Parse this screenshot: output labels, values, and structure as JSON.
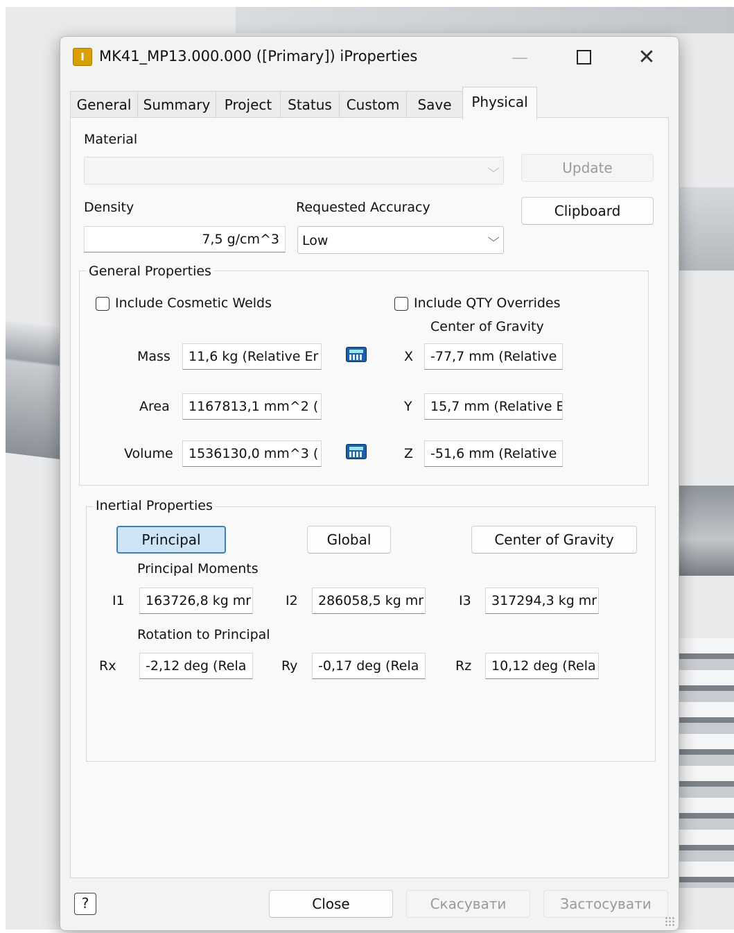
{
  "window": {
    "app_icon_letter": "I",
    "title": "MK41_MP13.000.000 ([Primary]) iProperties",
    "minimize_glyph": "—",
    "close_glyph": "✕"
  },
  "tabs": [
    {
      "label": "General"
    },
    {
      "label": "Summary"
    },
    {
      "label": "Project"
    },
    {
      "label": "Status"
    },
    {
      "label": "Custom"
    },
    {
      "label": "Save"
    },
    {
      "label": "Physical",
      "active": true
    }
  ],
  "physical": {
    "material_label": "Material",
    "material_value": "",
    "update_label": "Update",
    "density_label": "Density",
    "density_value": "7,5 g/cm^3",
    "accuracy_label": "Requested Accuracy",
    "accuracy_value": "Low",
    "clipboard_label": "Clipboard",
    "general_properties": {
      "title": "General Properties",
      "include_welds_label": "Include Cosmetic Welds",
      "include_welds_checked": false,
      "include_qty_label": "Include QTY Overrides",
      "include_qty_checked": false,
      "cog_label": "Center of Gravity",
      "mass_label": "Mass",
      "mass_value": "11,6 kg (Relative Er",
      "area_label": "Area",
      "area_value": "1167813,1 mm^2 (",
      "volume_label": "Volume",
      "volume_value": "1536130,0 mm^3 (",
      "x_label": "X",
      "x_value": "-77,7 mm (Relative",
      "y_label": "Y",
      "y_value": "15,7 mm (Relative E",
      "z_label": "Z",
      "z_value": "-51,6 mm (Relative"
    },
    "inertial_properties": {
      "title": "Inertial Properties",
      "principal_label": "Principal",
      "global_label": "Global",
      "cog_button_label": "Center of Gravity",
      "principal_moments_label": "Principal Moments",
      "i1_label": "I1",
      "i1_value": "163726,8 kg mr",
      "i2_label": "I2",
      "i2_value": "286058,5 kg mr",
      "i3_label": "I3",
      "i3_value": "317294,3 kg mr",
      "rotation_label": "Rotation to Principal",
      "rx_label": "Rx",
      "rx_value": "-2,12 deg (Rela",
      "ry_label": "Ry",
      "ry_value": "-0,17 deg (Rela",
      "rz_label": "Rz",
      "rz_value": "10,12 deg (Rela"
    }
  },
  "footer": {
    "help_glyph": "?",
    "close_label": "Close",
    "cancel_label": "Скасувати",
    "apply_label": "Застосувати"
  },
  "colors": {
    "pressed_button": "#cde4f7",
    "pressed_border": "#3c7fb1",
    "app_icon": "#d9a000",
    "calculator_icon": "#1b5fa8"
  }
}
